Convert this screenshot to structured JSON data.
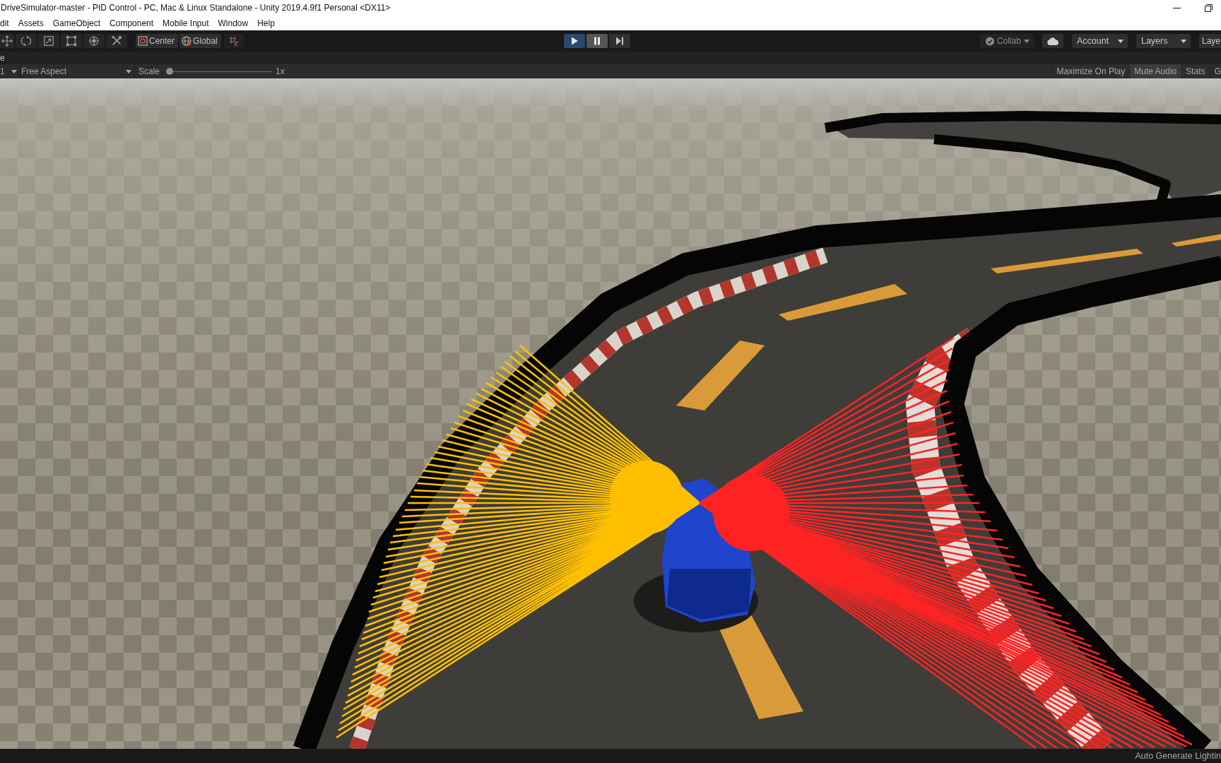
{
  "window": {
    "title": "DriveSimulator-master - PID Control - PC, Mac & Linux Standalone - Unity 2019.4.9f1 Personal <DX11>"
  },
  "menu": [
    "dit",
    "Assets",
    "GameObject",
    "Component",
    "Mobile Input",
    "Window",
    "Help"
  ],
  "toolbar": {
    "pivot_mode": "Center",
    "pivot_rotation": "Global",
    "play": {
      "on": true
    },
    "pause": {
      "on": true
    },
    "step": {
      "on": false
    },
    "collab": {
      "label": "Collab",
      "disabled": true
    },
    "account": "Account",
    "layers": "Layers",
    "layout": "Laye"
  },
  "tab": {
    "label": "e"
  },
  "game_toolbar": {
    "display": "1",
    "aspect": "Free Aspect",
    "scale_label": "Scale",
    "scale_slider": {
      "level": 0
    },
    "scale_reading": "1x",
    "toggles": [
      {
        "label": "Maximize On Play",
        "on": false
      },
      {
        "label": "Mute Audio",
        "on": true
      },
      {
        "label": "Stats",
        "on": false
      },
      {
        "label": "G",
        "on": false
      }
    ]
  },
  "status_bar": {
    "text": "Auto Generate Lightin"
  }
}
